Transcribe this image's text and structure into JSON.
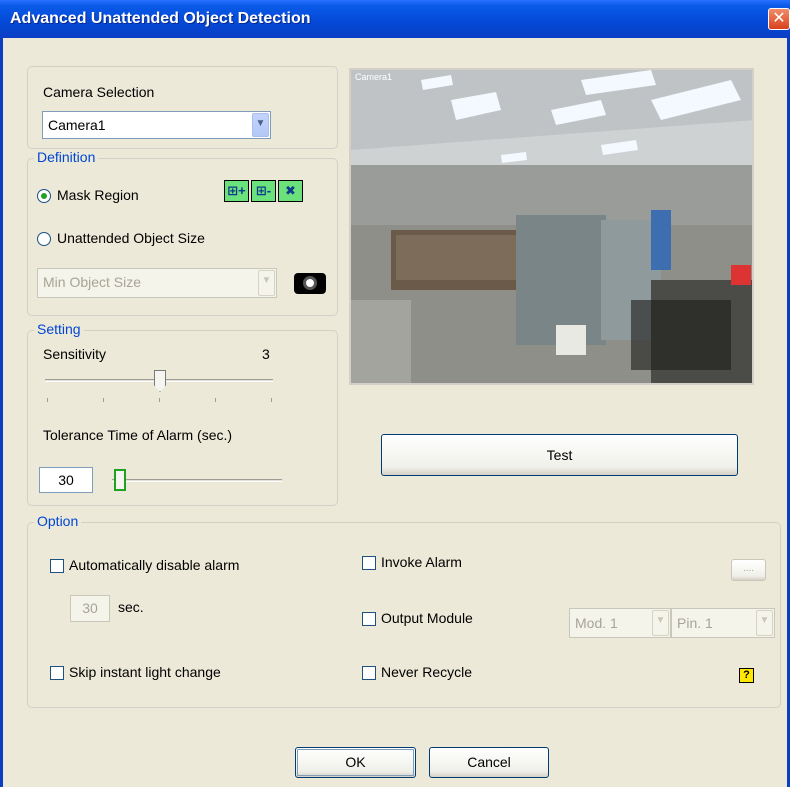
{
  "window": {
    "title": "Advanced Unattended Object Detection",
    "close_glyph": "✕"
  },
  "camera_selection": {
    "label": "Camera Selection",
    "selected": "Camera1"
  },
  "definition": {
    "legend": "Definition",
    "mask_region_label": "Mask Region",
    "unattended_size_label": "Unattended Object Size",
    "object_size_selected": "Min Object Size",
    "selected_option": "Mask Region"
  },
  "setting": {
    "legend": "Setting",
    "sensitivity_label": "Sensitivity",
    "sensitivity_value": "3",
    "tolerance_label": "Tolerance Time of Alarm (sec.)",
    "tolerance_value": "30"
  },
  "camera_view": {
    "overlay_label": "Camera1"
  },
  "test_button": "Test",
  "option": {
    "legend": "Option",
    "auto_disable_label": "Automatically disable alarm",
    "auto_disable_seconds": "30",
    "sec_label": "sec.",
    "skip_light_label": "Skip instant light change",
    "invoke_alarm_label": "Invoke Alarm",
    "invoke_alarm_button": "....",
    "output_module_label": "Output Module",
    "module_selected": "Mod. 1",
    "pin_selected": "Pin. 1",
    "never_recycle_label": "Never Recycle"
  },
  "buttons": {
    "ok": "OK",
    "cancel": "Cancel"
  },
  "colors": {
    "title_bar": "#0a3fc4",
    "legend_text": "#0046d5",
    "radio_dot": "#21a121"
  }
}
